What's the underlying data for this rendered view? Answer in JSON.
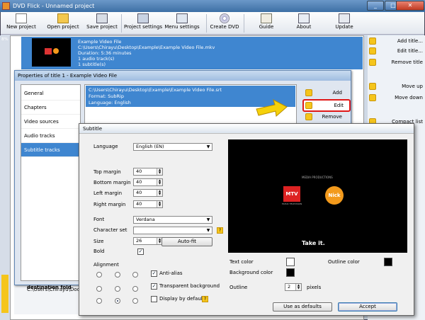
{
  "window": {
    "title": "DVD Flick - Unnamed project",
    "min": "_",
    "max": "□",
    "close": "✕"
  },
  "toolbar": [
    {
      "label": "New project",
      "icon": "new-project-icon"
    },
    {
      "label": "Open project",
      "icon": "open-folder-icon"
    },
    {
      "label": "Save project",
      "icon": "save-icon"
    },
    {
      "label": "Project settings",
      "icon": "settings-icon"
    },
    {
      "label": "Menu settings",
      "icon": "menu-icon"
    },
    {
      "label": "Create DVD",
      "icon": "disc-icon"
    },
    {
      "label": "Guide",
      "icon": "guide-icon"
    },
    {
      "label": "About",
      "icon": "about-icon"
    },
    {
      "label": "Update",
      "icon": "update-icon"
    }
  ],
  "sidebar": {
    "items": [
      "Add title...",
      "Edit title...",
      "Remove title",
      "Move up",
      "Move down",
      "Compact list"
    ]
  },
  "title_list": {
    "percent": "8%",
    "item": {
      "name": "Example Video File",
      "path": "C:\\Users\\Chirayu\\Desktop\\Example\\Example Video File.mkv",
      "duration": "Duration: 5:36 minutes",
      "audio": "1 audio track(s)",
      "subs": "1 subtitle(s)"
    }
  },
  "project_dest": {
    "label": "Project destination fold",
    "path": "C:\\Users\\Chirayu\\Docu"
  },
  "props": {
    "title": "Properties of title 1 - Example Video File",
    "nav": [
      "General",
      "Chapters",
      "Video sources",
      "Audio tracks",
      "Subtitle tracks"
    ],
    "selected_nav": 4,
    "subtitle_item": {
      "path": "C:\\Users\\Chirayu\\Desktop\\Example\\Example Video File.srt",
      "format": "Format: SubRip",
      "language": "Language: English"
    },
    "buttons": {
      "add": "Add",
      "edit": "Edit",
      "remove": "Remove"
    }
  },
  "subtitle_dialog": {
    "title": "Subtitle",
    "language_label": "Language",
    "language_value": "English (EN)",
    "top_margin_label": "Top margin",
    "top_margin": "40",
    "bottom_margin_label": "Bottom margin",
    "bottom_margin": "40",
    "left_margin_label": "Left margin",
    "left_margin": "40",
    "right_margin_label": "Right margin",
    "right_margin": "40",
    "font_label": "Font",
    "font_value": "Verdana",
    "charset_label": "Character set",
    "charset_value": "",
    "size_label": "Size",
    "size_value": "26",
    "autofit": "Auto-fit",
    "bold_label": "Bold",
    "bold_checked": true,
    "alignment_label": "Alignment",
    "antialias_label": "Anti-alias",
    "antialias_checked": true,
    "transparent_bg_label": "Transparent background",
    "transparent_bg_checked": true,
    "display_default_label": "Display by default",
    "display_default_checked": false,
    "help": "?",
    "text_color_label": "Text color",
    "text_color": "#ffffff",
    "outline_color_label": "Outline color",
    "outline_color": "#000000",
    "bg_color_label": "Background color",
    "bg_color": "#000000",
    "outline_label": "Outline",
    "outline_value": "2",
    "pixels_label": "pixels",
    "use_defaults": "Use as defaults",
    "accept": "Accept",
    "preview": {
      "caption": "Take it.",
      "logo_top": "MEDIA PRODUCTIONS",
      "mtv": "MTV",
      "mtv_sub": "MUSIC TELEVISION",
      "nick": "Nick"
    }
  },
  "colors": {
    "selection": "#3f86d0",
    "accent": "#f5c51c",
    "highlight_ring": "#e01818",
    "arrow": "#f5d10a"
  }
}
